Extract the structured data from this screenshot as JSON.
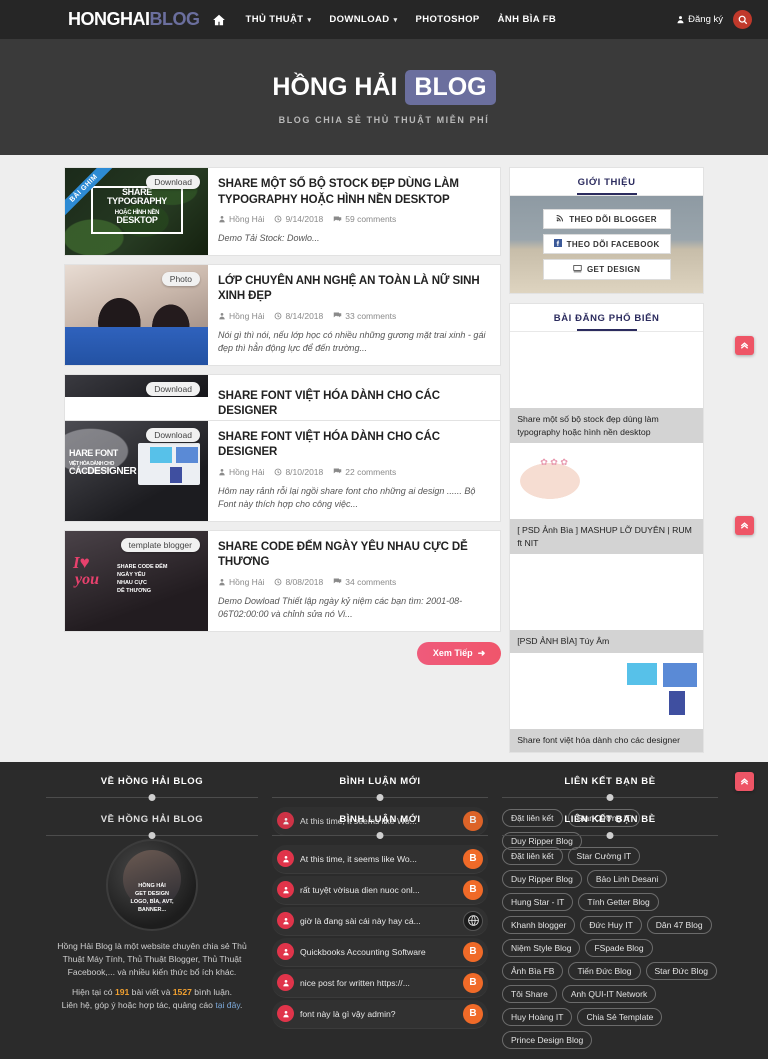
{
  "nav": {
    "logo_part1": "HONGHAI",
    "logo_part2": "BLOG",
    "home_icon": "home-icon",
    "items": [
      {
        "label": "THỦ THUẬT",
        "caret": "▾"
      },
      {
        "label": "DOWNLOAD",
        "caret": "▾"
      },
      {
        "label": "PHOTOSHOP",
        "caret": ""
      },
      {
        "label": "ẢNH BÌA FB",
        "caret": ""
      }
    ],
    "signup_label": "Đăng ký",
    "signup_icon": "user-icon",
    "search_icon": "search-icon"
  },
  "hero": {
    "title_a": "HỒNG HẢI",
    "title_badge": "BLOG",
    "subtitle": "BLOG CHIA SẺ THỦ THUẬT MIỄN PHÍ",
    "badge_color": "#6b6f9e"
  },
  "posts": [
    {
      "tag": "Download",
      "ribbon": "BÀI GHIM",
      "title": "SHARE MỘT SỐ BỘ STOCK ĐẸP DÙNG LÀM TYPOGRAPHY HOẶC HÌNH NỀN DESKTOP",
      "author": "Hồng Hải",
      "date": "9/14/2018",
      "comments": "59 comments",
      "snippet": "Demo Tải Stock: Dowlo..."
    },
    {
      "tag": "Photo",
      "ribbon": "",
      "title": "LỚP CHUYÊN ANH NGHỆ AN TOÀN LÀ NỮ SINH XINH ĐẸP",
      "author": "Hồng Hải",
      "date": "8/14/2018",
      "comments": "33 comments",
      "snippet": "Nói gì thì nói, nếu lớp học có nhiều những gương mặt trai xinh - gái đẹp thì hẳn động lực để đến trường..."
    },
    {
      "tag": "Download",
      "ribbon": "",
      "title": "SHARE FONT VIỆT HÓA DÀNH CHO CÁC DESIGNER",
      "author": "Hồng Hải",
      "date": "8/10/2018",
      "comments": "22 comments",
      "snippet": "Hôm nay rảnh rỗi lại ngồi share font cho những ai design ...... Bộ Font này thích hợp cho công việc..."
    },
    {
      "tag": "template blogger",
      "ribbon": "",
      "title": "SHARE CODE ĐẾM NGÀY YÊU NHAU CỰC DỄ THƯƠNG",
      "author": "Hồng Hải",
      "date": "8/08/2018",
      "comments": "34 comments",
      "snippet": "Demo Dowload Thiết lập ngày kỷ niệm các bạn tìm: 2001-08-06T02:00:00 và chỉnh sửa nó Vi..."
    }
  ],
  "pager": {
    "more_label": "Xem Tiếp",
    "more_icon": "arrow-right-icon"
  },
  "sidebar": {
    "intro": {
      "title": "GIỚI THIỆU",
      "buttons": [
        {
          "label": "THEO DÕI BLOGGER",
          "icon": "rss-icon"
        },
        {
          "label": "THEO DÕI FACEBOOK",
          "icon": "facebook-icon"
        },
        {
          "label": "GET DESIGN",
          "icon": "monitor-icon"
        }
      ]
    },
    "popular": {
      "title": "BÀI ĐĂNG PHỔ BIẾN",
      "items": [
        {
          "caption": "Share một số bộ stock đẹp dùng làm typography hoặc hình nền desktop"
        },
        {
          "caption": "[ PSD Ảnh Bìa ] MASHUP LỠ DUYÊN | RUM ft NIT"
        },
        {
          "caption": "[PSD ẢNH BÌA] Túy Âm"
        },
        {
          "caption": "Share font việt hóa dành cho các designer"
        }
      ]
    }
  },
  "footer": {
    "about": {
      "heading": "VỀ HỒNG HẢI BLOG",
      "avatar_caption_1": "HỒNG HẢI",
      "avatar_caption_2": "GET DESIGN",
      "avatar_caption_3": "LOGO, BÌA, AVT,",
      "avatar_caption_4": "BANNER...",
      "line1": "Hồng Hải Blog là một website chuyên chia sẻ Thủ Thuật Máy Tính, Thủ Thuật Blogger, Thủ Thuật Facebook,... và nhiều kiến thức bổ ích khác.",
      "stats_pre": "Hiện tại có ",
      "stats_posts": "191",
      "stats_mid": " bài viết và ",
      "stats_comments": "1527",
      "stats_post": " bình luận.",
      "contact_pre": "Liên hệ, góp ý hoặc hợp tác, quảng cáo ",
      "contact_link": "tại đây",
      "contact_post": "."
    },
    "comments": {
      "heading": "BÌNH LUẬN MỚI",
      "items": [
        {
          "text": "At this time, it seems like Wo...",
          "badge": "blogger-icon"
        },
        {
          "text": "rất tuyệt vờisua dien nuoc onl...",
          "badge": "blogger-icon"
        },
        {
          "text": "giờ là đang sài cái này hay cá...",
          "badge": "globe-icon"
        },
        {
          "text": "Quickbooks Accounting Software",
          "badge": "blogger-icon"
        },
        {
          "text": "nice post for written https://...",
          "badge": "blogger-icon"
        },
        {
          "text": "font này là gì vậy admin?",
          "badge": "blogger-icon"
        }
      ]
    },
    "links": {
      "heading": "LIÊN KẾT BẠN BÈ",
      "items": [
        "Đặt liên kết",
        "Star Cường IT",
        "Duy Ripper Blog",
        "Bảo Linh Desani",
        "Hung Star - IT",
        "Tính Getter Blog",
        "Khanh blogger",
        "Đức Huy IT",
        "Dân 47 Blog",
        "Niệm Style Blog",
        "FSpade Blog",
        "Ảnh Bìa FB",
        "Tiến Đức Blog",
        "Star Đức Blog",
        "Tôi Share",
        "Anh QUI-IT Network",
        "Huy Hoàng IT",
        "Chia Sẻ Template",
        "Prince Design Blog"
      ]
    }
  },
  "scroll_buttons": {
    "icon": "chevron-up-double-icon",
    "color": "#ee5566"
  }
}
